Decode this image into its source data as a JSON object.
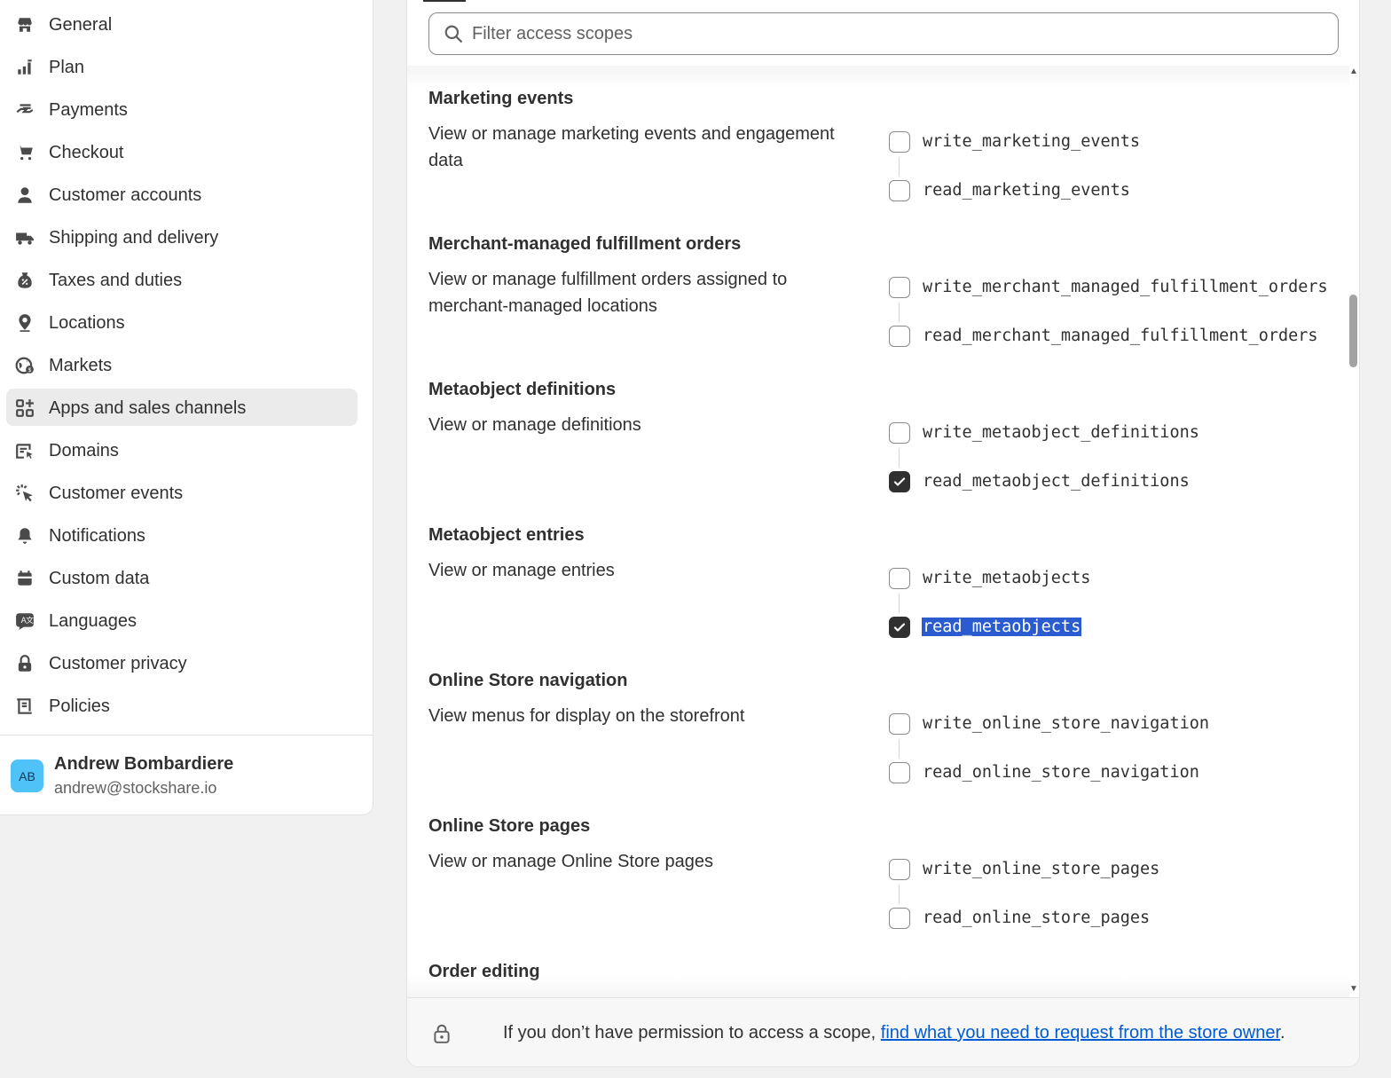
{
  "sidebar": {
    "items": [
      {
        "label": "General",
        "icon": "store-icon"
      },
      {
        "label": "Plan",
        "icon": "plan-icon"
      },
      {
        "label": "Payments",
        "icon": "payments-icon"
      },
      {
        "label": "Checkout",
        "icon": "cart-icon"
      },
      {
        "label": "Customer accounts",
        "icon": "person-icon"
      },
      {
        "label": "Shipping and delivery",
        "icon": "truck-icon"
      },
      {
        "label": "Taxes and duties",
        "icon": "tax-icon"
      },
      {
        "label": "Locations",
        "icon": "location-icon"
      },
      {
        "label": "Markets",
        "icon": "globe-icon"
      },
      {
        "label": "Apps and sales channels",
        "icon": "apps-icon",
        "active": true
      },
      {
        "label": "Domains",
        "icon": "domains-icon"
      },
      {
        "label": "Customer events",
        "icon": "cursor-click-icon"
      },
      {
        "label": "Notifications",
        "icon": "bell-icon"
      },
      {
        "label": "Custom data",
        "icon": "database-icon"
      },
      {
        "label": "Languages",
        "icon": "language-icon"
      },
      {
        "label": "Customer privacy",
        "icon": "lock-icon"
      },
      {
        "label": "Policies",
        "icon": "policy-icon"
      }
    ],
    "user": {
      "initials": "AB",
      "name": "Andrew Bombardiere",
      "email": "andrew@stockshare.io"
    }
  },
  "filter": {
    "placeholder": "Filter access scopes",
    "value": ""
  },
  "scopes": [
    {
      "title": "Marketing events",
      "description": "View or manage marketing events and engagement data",
      "write": {
        "label": "write_marketing_events",
        "checked": false
      },
      "read": {
        "label": "read_marketing_events",
        "checked": false
      }
    },
    {
      "title": "Merchant-managed fulfillment orders",
      "description": "View or manage fulfillment orders assigned to merchant-managed locations",
      "write": {
        "label": "write_merchant_managed_fulfillment_orders",
        "checked": false
      },
      "read": {
        "label": "read_merchant_managed_fulfillment_orders",
        "checked": false
      }
    },
    {
      "title": "Metaobject definitions",
      "description": "View or manage definitions",
      "write": {
        "label": "write_metaobject_definitions",
        "checked": false
      },
      "read": {
        "label": "read_metaobject_definitions",
        "checked": true
      }
    },
    {
      "title": "Metaobject entries",
      "description": "View or manage entries",
      "write": {
        "label": "write_metaobjects",
        "checked": false
      },
      "read": {
        "label": "read_metaobjects",
        "checked": true,
        "highlighted": true
      }
    },
    {
      "title": "Online Store navigation",
      "description": "View menus for display on the storefront",
      "write": {
        "label": "write_online_store_navigation",
        "checked": false
      },
      "read": {
        "label": "read_online_store_navigation",
        "checked": false
      }
    },
    {
      "title": "Online Store pages",
      "description": "View or manage Online Store pages",
      "write": {
        "label": "write_online_store_pages",
        "checked": false
      },
      "read": {
        "label": "read_online_store_pages",
        "checked": false
      }
    },
    {
      "title": "Order editing",
      "description": "",
      "write": null,
      "read": null
    }
  ],
  "footer": {
    "text": "If you don’t have permission to access a scope, ",
    "link": "find what you need to request from the store owner",
    "end": "."
  },
  "colors": {
    "accent_link": "#005bd3",
    "selection": "#2a5ccf",
    "checked": "#303030",
    "active_nav_bg": "#ebebeb"
  }
}
